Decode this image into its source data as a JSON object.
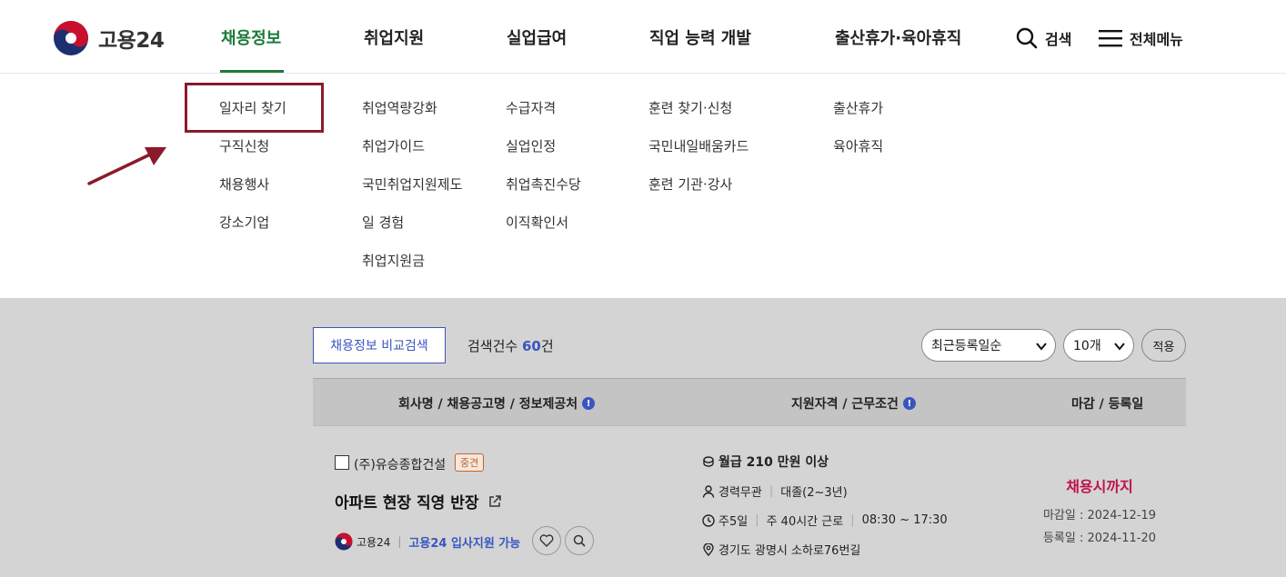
{
  "header": {
    "logo_text": "고용24",
    "nav": [
      {
        "label": "채용정보"
      },
      {
        "label": "취업지원"
      },
      {
        "label": "실업급여"
      },
      {
        "label": "직업 능력 개발"
      },
      {
        "label": "출산휴가·육아휴직"
      }
    ],
    "search_label": "검색",
    "menu_label": "전체메뉴"
  },
  "mega_menu": {
    "col1": [
      "일자리 찾기",
      "구직신청",
      "채용행사",
      "강소기업"
    ],
    "col2": [
      "취업역량강화",
      "취업가이드",
      "국민취업지원제도",
      "일 경험",
      "취업지원금"
    ],
    "col3": [
      "수급자격",
      "실업인정",
      "취업촉진수당",
      "이직확인서"
    ],
    "col4": [
      "훈련 찾기·신청",
      "국민내일배움카드",
      "훈련 기관·강사"
    ],
    "col5": [
      "출산휴가",
      "육아휴직"
    ]
  },
  "toolbar": {
    "compare_label": "채용정보 비교검색",
    "count_prefix": "검색건수 ",
    "count_value": "60",
    "count_suffix": "건",
    "sort_value": "최근등록일순",
    "page_size_value": "10개",
    "apply_label": "적용"
  },
  "table": {
    "headers": [
      "회사명 / 채용공고명 / 정보제공처",
      "지원자격 / 근무조건",
      "마감 / 등록일"
    ]
  },
  "listing": {
    "company": "(주)유승종합건설",
    "badge": "중견",
    "title": "아파트 현장 직영 반장",
    "source": "고용24",
    "apply_text": "고용24 입사지원 가능",
    "salary": "월급 210 만원 이상",
    "career": "경력무관",
    "education": "대졸(2~3년)",
    "days": "주5일",
    "hours": "주 40시간 근로",
    "time": "08:30 ~ 17:30",
    "location": "경기도 광명시 소하로76번길",
    "deadline_status": "채용시까지",
    "deadline": "마감일 : 2024-12-19",
    "registered": "등록일 : 2024-11-20"
  },
  "colors": {
    "brand_green": "#1e7b3a",
    "accent_blue": "#3a55c0",
    "highlight": "#8b1a2b",
    "deadline_red": "#c0124a"
  }
}
